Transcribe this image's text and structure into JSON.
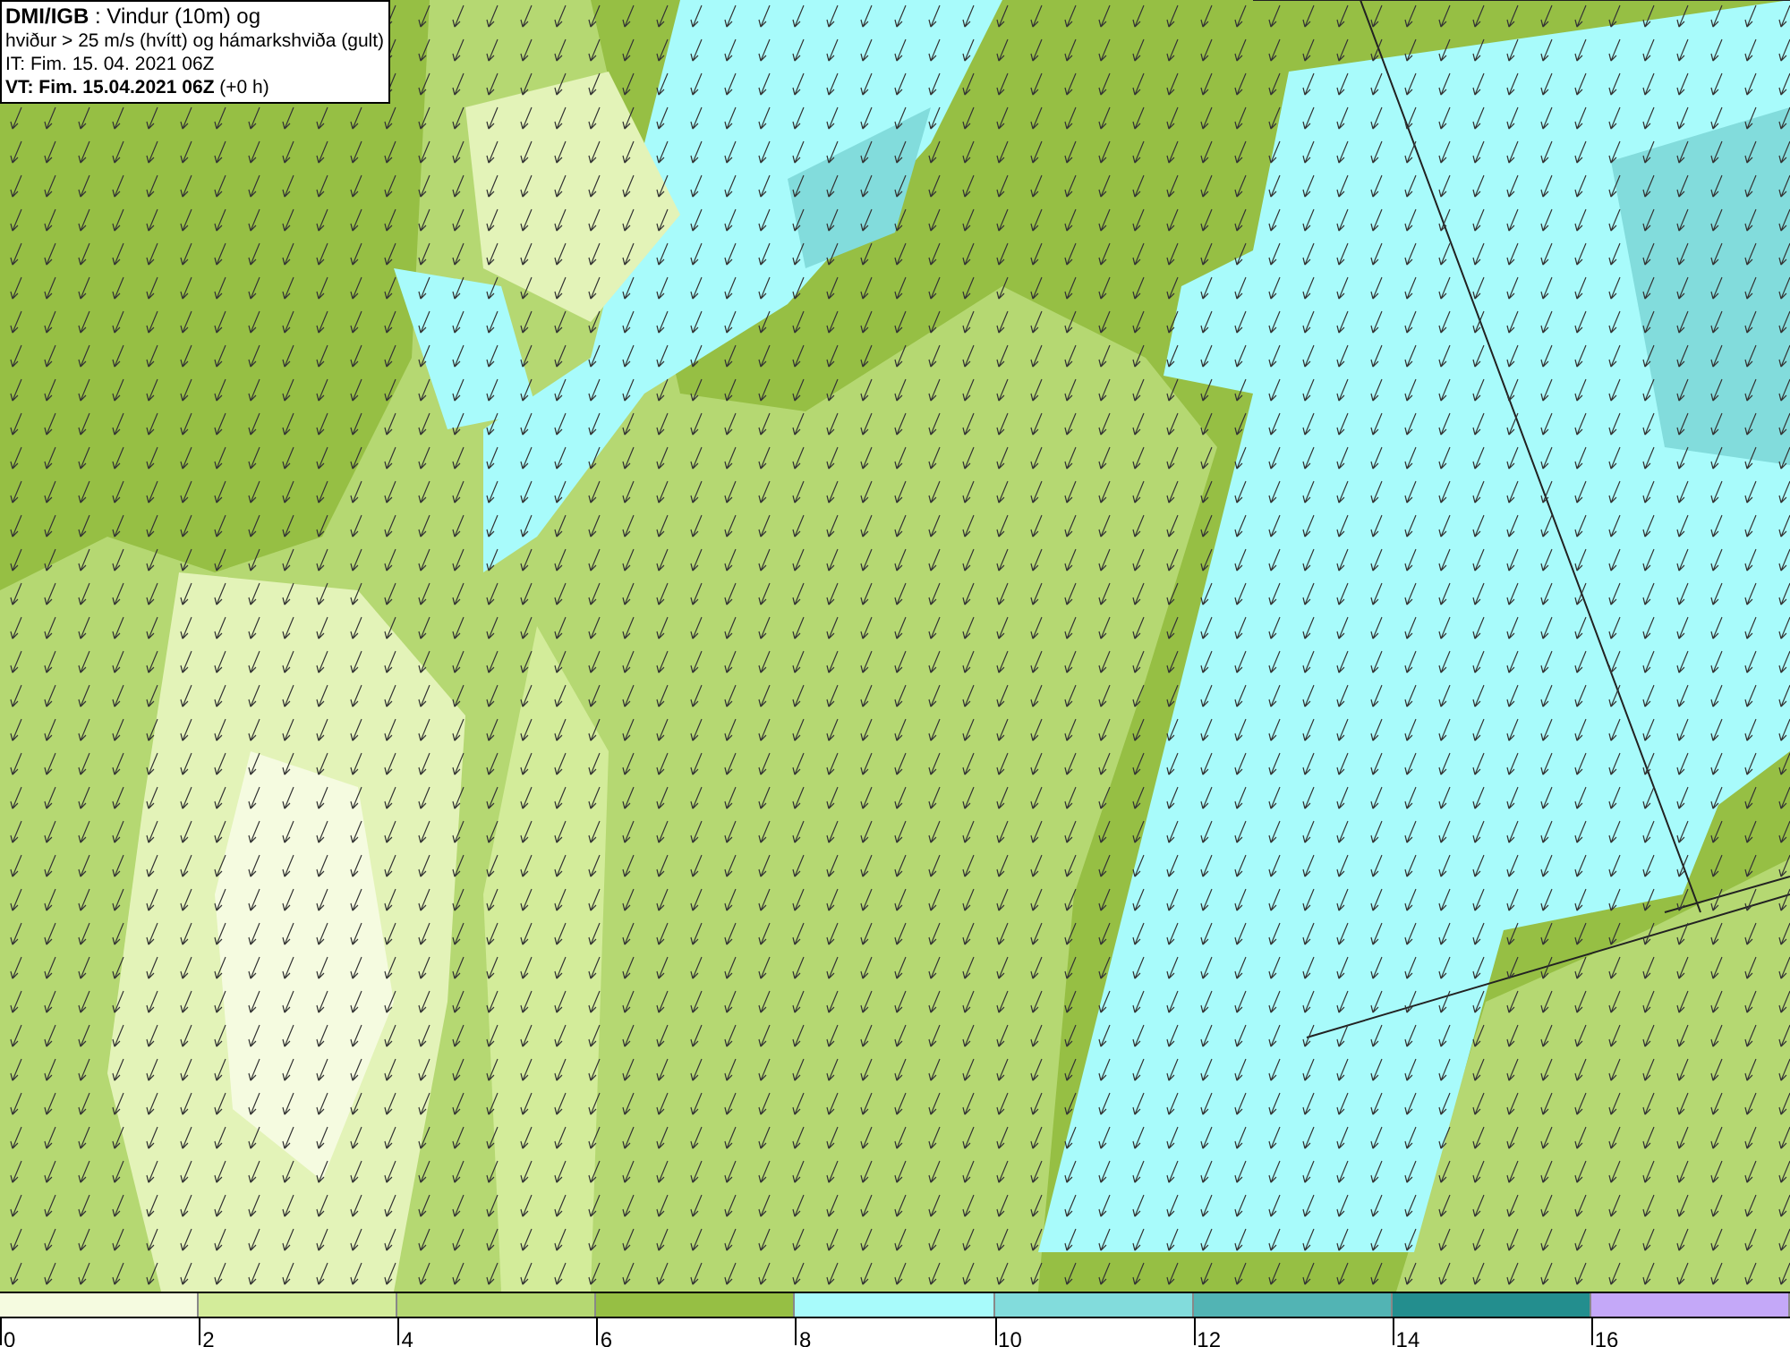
{
  "legend": {
    "lines": [
      "**DMI/IGB** : Vindur (10m) og",
      "hviður > 25 m/s (hvítt) og hámarkshviða (gult)",
      "IT: Fim. 15. 04. 2021 06Z",
      "**VT: Fim. 15.04.2021 06Z** (+0 h)"
    ]
  },
  "scale": [
    {
      "label": "0",
      "color": "#f5fbe0"
    },
    {
      "label": "2",
      "color": "#d3ec9a"
    },
    {
      "label": "4",
      "color": "#b5d872"
    },
    {
      "label": "6",
      "color": "#96bf44"
    },
    {
      "label": "8",
      "color": "#a8fbfb"
    },
    {
      "label": "10",
      "color": "#82dcdc"
    },
    {
      "label": "12",
      "color": "#52b4b4"
    },
    {
      "label": "14",
      "color": "#238e8e"
    },
    {
      "label": "16",
      "color": "#c4a8f8"
    }
  ]
}
